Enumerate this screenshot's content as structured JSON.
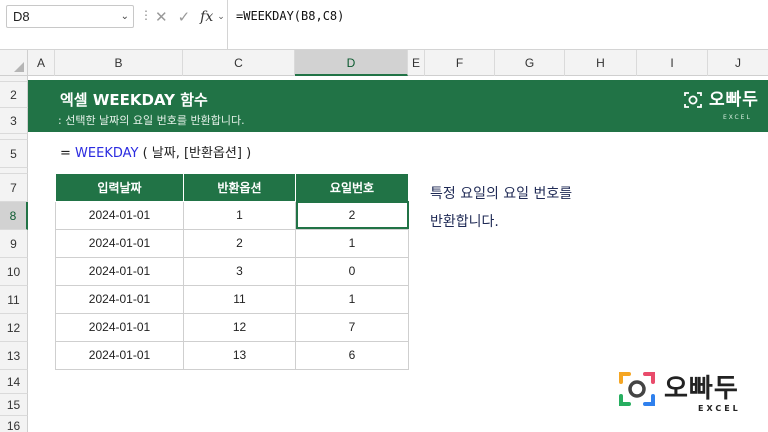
{
  "formula_bar": {
    "name_box": "D8",
    "formula": "=WEEKDAY(B8,C8)",
    "fx_label": "fx"
  },
  "columns": [
    "A",
    "B",
    "C",
    "D",
    "E",
    "F",
    "G",
    "H",
    "I",
    "J"
  ],
  "rows": [
    "2",
    "3",
    "5",
    "7",
    "8",
    "9",
    "10",
    "11",
    "12",
    "13",
    "14",
    "15",
    "16"
  ],
  "banner": {
    "title": "엑셀 WEEKDAY 함수",
    "subtitle": ": 선택한 날짜의 요일 번호를 반환합니다.",
    "logo_text": "오빠두",
    "logo_sub": "EXCEL"
  },
  "syntax": {
    "prefix": "= ",
    "function": "WEEKDAY",
    "args": " ( 날짜, [반환옵션] )"
  },
  "table": {
    "headers": [
      "입력날짜",
      "반환옵션",
      "요일번호"
    ],
    "rows": [
      [
        "2024-01-01",
        "1",
        "2"
      ],
      [
        "2024-01-01",
        "2",
        "1"
      ],
      [
        "2024-01-01",
        "3",
        "0"
      ],
      [
        "2024-01-01",
        "11",
        "1"
      ],
      [
        "2024-01-01",
        "12",
        "7"
      ],
      [
        "2024-01-01",
        "13",
        "6"
      ]
    ]
  },
  "note": {
    "line1": "특정 요일의 요일 번호를",
    "line2": "반환합니다."
  },
  "logo_bottom": {
    "text": "오빠두",
    "sub": "EXCEL"
  },
  "colors": {
    "excel_green": "#217346",
    "function_blue": "#2b2be0"
  }
}
